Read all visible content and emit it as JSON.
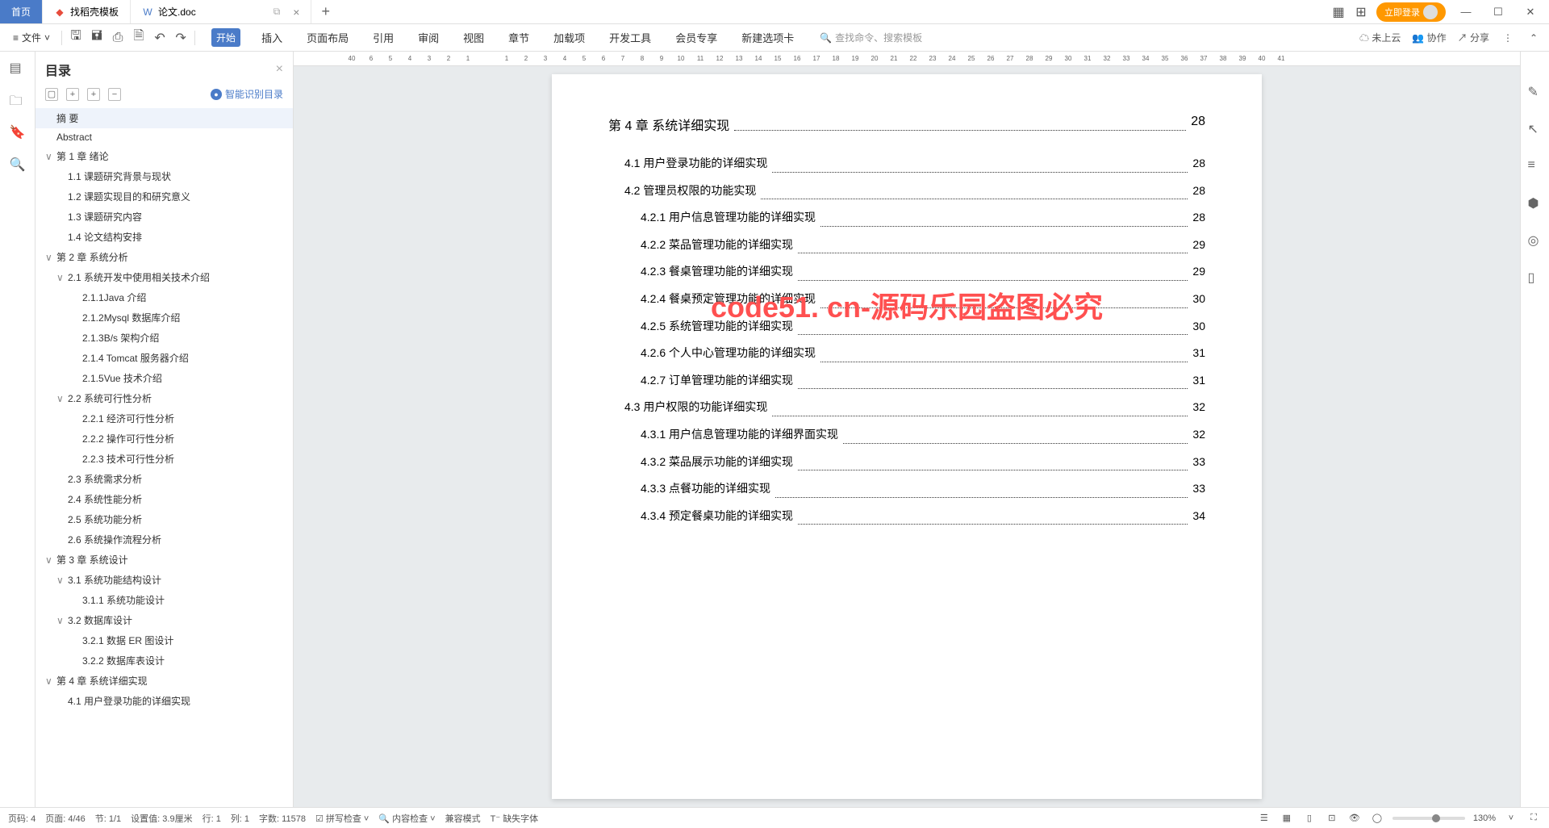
{
  "tabs": {
    "home": "首页",
    "template": "找稻壳模板",
    "doc": "论文.doc"
  },
  "login_btn": "立即登录",
  "file_menu": "文件",
  "menu_tabs": {
    "start": "开始",
    "insert": "插入",
    "layout": "页面布局",
    "ref": "引用",
    "review": "审阅",
    "view": "视图",
    "chapter": "章节",
    "addon": "加载项",
    "devtool": "开发工具",
    "member": "会员专享",
    "newtab": "新建选项卡"
  },
  "search_placeholder": "查找命令、搜索模板",
  "cloud": "未上云",
  "collab": "协作",
  "share": "分享",
  "outline": {
    "title": "目录",
    "badge": "智能识别目录"
  },
  "tree": [
    {
      "lvl": 0,
      "tw": "",
      "label": "摘  要",
      "sel": true
    },
    {
      "lvl": 0,
      "tw": "",
      "label": "Abstract"
    },
    {
      "lvl": 0,
      "tw": "∨",
      "label": "第 1 章  绪论"
    },
    {
      "lvl": 1,
      "tw": "",
      "label": "1.1 课题研究背景与现状"
    },
    {
      "lvl": 1,
      "tw": "",
      "label": "1.2 课题实现目的和研究意义"
    },
    {
      "lvl": 1,
      "tw": "",
      "label": "1.3 课题研究内容"
    },
    {
      "lvl": 1,
      "tw": "",
      "label": "1.4 论文结构安排"
    },
    {
      "lvl": 0,
      "tw": "∨",
      "label": "第 2 章  系统分析"
    },
    {
      "lvl": 1,
      "tw": "∨",
      "label": "2.1 系统开发中使用相关技术介绍"
    },
    {
      "lvl": 2,
      "tw": "",
      "label": "2.1.1Java 介绍"
    },
    {
      "lvl": 2,
      "tw": "",
      "label": "2.1.2Mysql 数据库介绍"
    },
    {
      "lvl": 2,
      "tw": "",
      "label": "2.1.3B/s 架构介绍"
    },
    {
      "lvl": 2,
      "tw": "",
      "label": "2.1.4 Tomcat 服务器介绍"
    },
    {
      "lvl": 2,
      "tw": "",
      "label": "2.1.5Vue 技术介绍"
    },
    {
      "lvl": 1,
      "tw": "∨",
      "label": "2.2 系统可行性分析"
    },
    {
      "lvl": 2,
      "tw": "",
      "label": "2.2.1 经济可行性分析"
    },
    {
      "lvl": 2,
      "tw": "",
      "label": "2.2.2 操作可行性分析"
    },
    {
      "lvl": 2,
      "tw": "",
      "label": "2.2.3 技术可行性分析"
    },
    {
      "lvl": 1,
      "tw": "",
      "label": "2.3 系统需求分析"
    },
    {
      "lvl": 1,
      "tw": "",
      "label": "2.4 系统性能分析"
    },
    {
      "lvl": 1,
      "tw": "",
      "label": "2.5 系统功能分析"
    },
    {
      "lvl": 1,
      "tw": "",
      "label": "2.6 系统操作流程分析"
    },
    {
      "lvl": 0,
      "tw": "∨",
      "label": "第 3 章  系统设计"
    },
    {
      "lvl": 1,
      "tw": "∨",
      "label": "3.1 系统功能结构设计"
    },
    {
      "lvl": 2,
      "tw": "",
      "label": "3.1.1 系统功能设计"
    },
    {
      "lvl": 1,
      "tw": "∨",
      "label": "3.2 数据库设计"
    },
    {
      "lvl": 2,
      "tw": "",
      "label": "3.2.1 数据 ER 图设计"
    },
    {
      "lvl": 2,
      "tw": "",
      "label": "3.2.2 数据库表设计"
    },
    {
      "lvl": 0,
      "tw": "∨",
      "label": "第 4 章  系统详细实现"
    },
    {
      "lvl": 1,
      "tw": "",
      "label": "4.1 用户登录功能的详细实现"
    }
  ],
  "toc_heading": {
    "txt": "第 4 章  系统详细实现",
    "pg": "28"
  },
  "toc": [
    {
      "ind": 1,
      "txt": "4.1 用户登录功能的详细实现",
      "pg": "28"
    },
    {
      "ind": 1,
      "txt": "4.2 管理员权限的功能实现",
      "pg": "28"
    },
    {
      "ind": 2,
      "txt": "4.2.1 用户信息管理功能的详细实现",
      "pg": "28"
    },
    {
      "ind": 2,
      "txt": "4.2.2 菜品管理功能的详细实现",
      "pg": "29"
    },
    {
      "ind": 2,
      "txt": "4.2.3 餐桌管理功能的详细实现",
      "pg": "29"
    },
    {
      "ind": 2,
      "txt": "4.2.4 餐桌预定管理功能的详细实现",
      "pg": "30"
    },
    {
      "ind": 2,
      "txt": "4.2.5 系统管理功能的详细实现",
      "pg": "30"
    },
    {
      "ind": 2,
      "txt": "4.2.6 个人中心管理功能的详细实现",
      "pg": "31"
    },
    {
      "ind": 2,
      "txt": "4.2.7 订单管理功能的详细实现",
      "pg": "31"
    },
    {
      "ind": 1,
      "txt": "4.3 用户权限的功能详细实现",
      "pg": "32"
    },
    {
      "ind": 2,
      "txt": "4.3.1 用户信息管理功能的详细界面实现",
      "pg": "32"
    },
    {
      "ind": 2,
      "txt": "4.3.2 菜品展示功能的详细实现",
      "pg": "33"
    },
    {
      "ind": 2,
      "txt": "4.3.3 点餐功能的详细实现",
      "pg": "33"
    },
    {
      "ind": 2,
      "txt": "4.3.4 预定餐桌功能的详细实现",
      "pg": "34"
    }
  ],
  "watermark": "code51. cn-源码乐园盗图必究",
  "ruler": [
    "40",
    "6",
    "5",
    "4",
    "3",
    "2",
    "1",
    "",
    "1",
    "2",
    "3",
    "4",
    "5",
    "6",
    "7",
    "8",
    "9",
    "10",
    "11",
    "12",
    "13",
    "14",
    "15",
    "16",
    "17",
    "18",
    "19",
    "20",
    "21",
    "22",
    "23",
    "24",
    "25",
    "26",
    "27",
    "28",
    "29",
    "30",
    "31",
    "32",
    "33",
    "34",
    "35",
    "36",
    "37",
    "38",
    "39",
    "40",
    "41"
  ],
  "status": {
    "page_label": "页码: 4",
    "pages": "页面: 4/46",
    "section": "节: 1/1",
    "pos": "设置值: 3.9厘米",
    "row": "行: 1",
    "col": "列: 1",
    "words": "字数: 11578",
    "spell": "拼写检查",
    "content_check": "内容检查",
    "compat": "兼容模式",
    "missing_font": "缺失字体",
    "zoom": "130%"
  }
}
